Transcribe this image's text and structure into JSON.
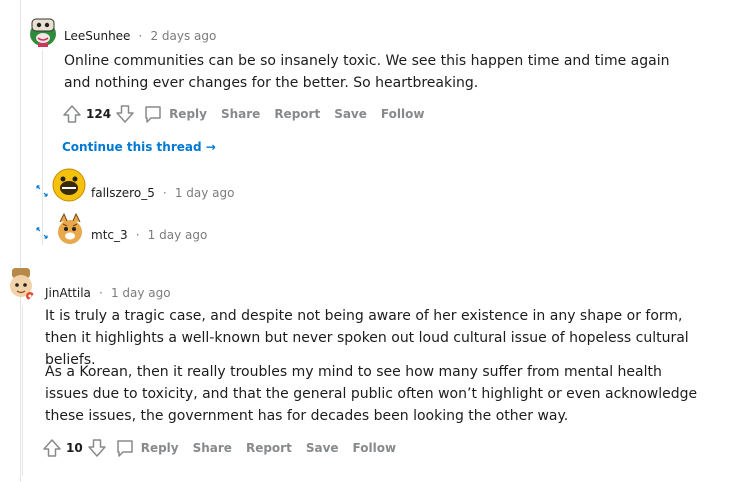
{
  "comment1": {
    "username": "LeeSunhee",
    "time": "2 days ago",
    "text": "Online communities can be so insanely toxic. We see this happen time and time again and nothing ever changes for the better. So heartbreaking.",
    "votes": "124",
    "actions": [
      "Reply",
      "Share",
      "Report",
      "Save",
      "Follow"
    ],
    "continue_label": "Continue this thread"
  },
  "collapsed": [
    {
      "username": "fallszero_5",
      "time": "1 day ago"
    },
    {
      "username": "mtc_3",
      "time": "1 day ago"
    }
  ],
  "comment2": {
    "username": "JinAttila",
    "time": "1 day ago",
    "paragraphs": [
      "It is truly a tragic case, and despite not being aware of her existence in any shape or form, then it highlights a well-known but never spoken out loud cultural issue of hopeless cultural beliefs.",
      "As a Korean, then it really troubles my mind to see how many suffer from mental health issues due to toxicity, and that the general public often won’t highlight or even acknowledge these issues, the government has for decades been looking the other way."
    ],
    "votes": "10",
    "actions": [
      "Reply",
      "Share",
      "Report",
      "Save",
      "Follow"
    ]
  },
  "meta_separator": "·",
  "colors": {
    "link": "#0079d3",
    "muted": "#878a8c",
    "thread_line": "#e3e5e8"
  }
}
